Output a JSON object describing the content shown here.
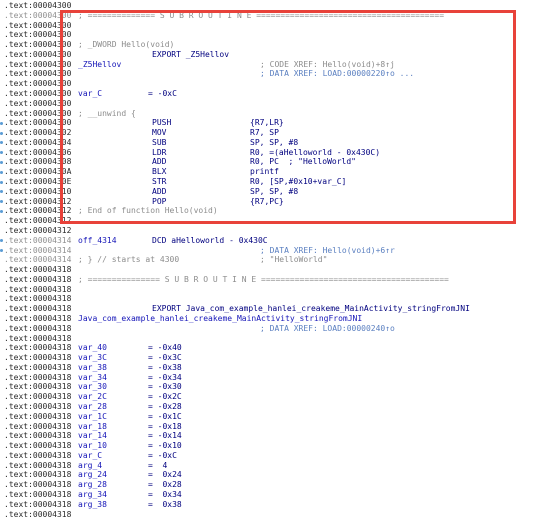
{
  "colors": {
    "address": "#2a2a2a",
    "address_grey": "#909090",
    "label_blue": "#1515b8",
    "mnemonic": "#00007f",
    "operand": "#00007f",
    "comment_grey": "#8c8c8c",
    "xref_blue": "#5a7fc0",
    "highlight_border": "#e8423a",
    "gutter_dot": "#5a9bd4"
  },
  "lines": [
    {
      "addr": ".text:00004300",
      "addr_style": "normal",
      "label": "",
      "mn": "",
      "op": "",
      "cmt": ""
    },
    {
      "addr": ".text:00004300",
      "addr_style": "grey",
      "label": "; ============== S U B R O U T I N E =======================================",
      "mn": "",
      "op": "",
      "cmt": "",
      "label_style": "grey"
    },
    {
      "addr": ".text:00004300",
      "addr_style": "normal",
      "label": "",
      "mn": "",
      "op": "",
      "cmt": ""
    },
    {
      "addr": ".text:00004300",
      "addr_style": "normal",
      "label": "",
      "mn": "",
      "op": "",
      "cmt": ""
    },
    {
      "addr": ".text:00004300",
      "addr_style": "normal",
      "label": "; _DWORD Hello(void)",
      "mn": "",
      "op": "",
      "cmt": "",
      "label_style": "grey"
    },
    {
      "addr": ".text:00004300",
      "addr_style": "normal",
      "label": "",
      "mn": "EXPORT _Z5Hellov",
      "op": "",
      "cmt": ""
    },
    {
      "addr": ".text:00004300",
      "addr_style": "normal",
      "label": "_Z5Hellov",
      "mn": "",
      "op": "",
      "cmt": "; CODE XREF: Hello(void)+8↑j",
      "label_style": "blue"
    },
    {
      "addr": ".text:00004300",
      "addr_style": "normal",
      "label": "",
      "mn": "",
      "op": "",
      "cmt": "; DATA XREF: LOAD:00000220↑o ...",
      "xref": true
    },
    {
      "addr": ".text:00004300",
      "addr_style": "normal",
      "label": "",
      "mn": "",
      "op": "",
      "cmt": ""
    },
    {
      "addr": ".text:00004300",
      "addr_style": "normal",
      "label": "var_C",
      "eq": "= -0xC",
      "mn": "",
      "op": "",
      "cmt": "",
      "label_style": "blue"
    },
    {
      "addr": ".text:00004300",
      "addr_style": "normal",
      "label": "",
      "mn": "",
      "op": "",
      "cmt": ""
    },
    {
      "addr": ".text:00004300",
      "addr_style": "normal",
      "label": "; __unwind {",
      "mn": "",
      "op": "",
      "cmt": "",
      "label_style": "grey"
    },
    {
      "addr": ".text:00004300",
      "addr_style": "normal",
      "label": "",
      "mn": "PUSH",
      "op": "{R7,LR}",
      "cmt": ""
    },
    {
      "addr": ".text:00004302",
      "addr_style": "normal",
      "label": "",
      "mn": "MOV",
      "op": "R7, SP",
      "cmt": ""
    },
    {
      "addr": ".text:00004304",
      "addr_style": "normal",
      "label": "",
      "mn": "SUB",
      "op": "SP, SP, #8",
      "cmt": ""
    },
    {
      "addr": ".text:00004306",
      "addr_style": "normal",
      "label": "",
      "mn": "LDR",
      "op": "R0, =(aHelloworld - 0x430C)",
      "cmt": ""
    },
    {
      "addr": ".text:00004308",
      "addr_style": "normal",
      "label": "",
      "mn": "ADD",
      "op": "R0, PC  ; \"HelloWorld\"",
      "cmt": ""
    },
    {
      "addr": ".text:0000430A",
      "addr_style": "normal",
      "label": "",
      "mn": "BLX",
      "op": "printf",
      "cmt": ""
    },
    {
      "addr": ".text:0000430E",
      "addr_style": "normal",
      "label": "",
      "mn": "STR",
      "op": "R0, [SP,#0x10+var_C]",
      "cmt": ""
    },
    {
      "addr": ".text:00004310",
      "addr_style": "normal",
      "label": "",
      "mn": "ADD",
      "op": "SP, SP, #8",
      "cmt": ""
    },
    {
      "addr": ".text:00004312",
      "addr_style": "normal",
      "label": "",
      "mn": "POP",
      "op": "{R7,PC}",
      "cmt": ""
    },
    {
      "addr": ".text:00004312",
      "addr_style": "normal",
      "label": "; End of function Hello(void)",
      "mn": "",
      "op": "",
      "cmt": "",
      "label_style": "grey"
    },
    {
      "addr": ".text:00004312",
      "addr_style": "normal",
      "label": "",
      "mn": "",
      "op": "",
      "cmt": ""
    },
    {
      "addr": ".text:00004312",
      "addr_style": "normal",
      "label": "",
      "mn": "",
      "op": "",
      "cmt": ""
    },
    {
      "addr": ".text:00004314",
      "addr_style": "grey",
      "label": "off_4314",
      "mn": "DCD aHelloworld - 0x430C",
      "op": "",
      "cmt": "",
      "label_style": "blue"
    },
    {
      "addr": ".text:00004314",
      "addr_style": "grey",
      "label": "",
      "mn": "",
      "op": "",
      "cmt": "; DATA XREF: Hello(void)+6↑r",
      "xref": true
    },
    {
      "addr": ".text:00004314",
      "addr_style": "grey",
      "label": "; } // starts at 4300",
      "mn": "",
      "op": "",
      "cmt": "; \"HelloWorld\"",
      "label_style": "grey",
      "cmt_grey": true
    },
    {
      "addr": ".text:00004318",
      "addr_style": "normal",
      "label": "",
      "mn": "",
      "op": "",
      "cmt": ""
    },
    {
      "addr": ".text:00004318",
      "addr_style": "normal",
      "label": "; =============== S U B R O U T I N E =======================================",
      "mn": "",
      "op": "",
      "cmt": "",
      "label_style": "grey"
    },
    {
      "addr": ".text:00004318",
      "addr_style": "normal",
      "label": "",
      "mn": "",
      "op": "",
      "cmt": ""
    },
    {
      "addr": ".text:00004318",
      "addr_style": "normal",
      "label": "",
      "mn": "",
      "op": "",
      "cmt": ""
    },
    {
      "addr": ".text:00004318",
      "addr_style": "normal",
      "label": "",
      "mn": "EXPORT Java_com_example_hanlei_creakeme_MainActivity_stringFromJNI",
      "op": "",
      "cmt": ""
    },
    {
      "addr": ".text:00004318",
      "addr_style": "normal",
      "label": "Java_com_example_hanlei_creakeme_MainActivity_stringFromJNI",
      "mn": "",
      "op": "",
      "cmt": "",
      "label_style": "blue"
    },
    {
      "addr": ".text:00004318",
      "addr_style": "normal",
      "label": "",
      "mn": "",
      "op": "",
      "cmt": "; DATA XREF: LOAD:00000240↑o",
      "xref": true
    },
    {
      "addr": ".text:00004318",
      "addr_style": "normal",
      "label": "",
      "mn": "",
      "op": "",
      "cmt": ""
    },
    {
      "addr": ".text:00004318",
      "addr_style": "normal",
      "label": "var_40",
      "eq": "= -0x40",
      "mn": "",
      "op": "",
      "cmt": "",
      "label_style": "blue"
    },
    {
      "addr": ".text:00004318",
      "addr_style": "normal",
      "label": "var_3C",
      "eq": "= -0x3C",
      "mn": "",
      "op": "",
      "cmt": "",
      "label_style": "blue"
    },
    {
      "addr": ".text:00004318",
      "addr_style": "normal",
      "label": "var_38",
      "eq": "= -0x38",
      "mn": "",
      "op": "",
      "cmt": "",
      "label_style": "blue"
    },
    {
      "addr": ".text:00004318",
      "addr_style": "normal",
      "label": "var_34",
      "eq": "= -0x34",
      "mn": "",
      "op": "",
      "cmt": "",
      "label_style": "blue"
    },
    {
      "addr": ".text:00004318",
      "addr_style": "normal",
      "label": "var_30",
      "eq": "= -0x30",
      "mn": "",
      "op": "",
      "cmt": "",
      "label_style": "blue"
    },
    {
      "addr": ".text:00004318",
      "addr_style": "normal",
      "label": "var_2C",
      "eq": "= -0x2C",
      "mn": "",
      "op": "",
      "cmt": "",
      "label_style": "blue"
    },
    {
      "addr": ".text:00004318",
      "addr_style": "normal",
      "label": "var_28",
      "eq": "= -0x28",
      "mn": "",
      "op": "",
      "cmt": "",
      "label_style": "blue"
    },
    {
      "addr": ".text:00004318",
      "addr_style": "normal",
      "label": "var_1C",
      "eq": "= -0x1C",
      "mn": "",
      "op": "",
      "cmt": "",
      "label_style": "blue"
    },
    {
      "addr": ".text:00004318",
      "addr_style": "normal",
      "label": "var_18",
      "eq": "= -0x18",
      "mn": "",
      "op": "",
      "cmt": "",
      "label_style": "blue"
    },
    {
      "addr": ".text:00004318",
      "addr_style": "normal",
      "label": "var_14",
      "eq": "= -0x14",
      "mn": "",
      "op": "",
      "cmt": "",
      "label_style": "blue"
    },
    {
      "addr": ".text:00004318",
      "addr_style": "normal",
      "label": "var_10",
      "eq": "= -0x10",
      "mn": "",
      "op": "",
      "cmt": "",
      "label_style": "blue"
    },
    {
      "addr": ".text:00004318",
      "addr_style": "normal",
      "label": "var_C",
      "eq": "= -0xC",
      "mn": "",
      "op": "",
      "cmt": "",
      "label_style": "blue"
    },
    {
      "addr": ".text:00004318",
      "addr_style": "normal",
      "label": "arg_4",
      "eq": "=  4",
      "mn": "",
      "op": "",
      "cmt": "",
      "label_style": "blue"
    },
    {
      "addr": ".text:00004318",
      "addr_style": "normal",
      "label": "arg_24",
      "eq": "=  0x24",
      "mn": "",
      "op": "",
      "cmt": "",
      "label_style": "blue"
    },
    {
      "addr": ".text:00004318",
      "addr_style": "normal",
      "label": "arg_28",
      "eq": "=  0x28",
      "mn": "",
      "op": "",
      "cmt": "",
      "label_style": "blue"
    },
    {
      "addr": ".text:00004318",
      "addr_style": "normal",
      "label": "arg_34",
      "eq": "=  0x34",
      "mn": "",
      "op": "",
      "cmt": "",
      "label_style": "blue"
    },
    {
      "addr": ".text:00004318",
      "addr_style": "normal",
      "label": "arg_38",
      "eq": "=  0x38",
      "mn": "",
      "op": "",
      "cmt": "",
      "label_style": "blue"
    },
    {
      "addr": ".text:00004318",
      "addr_style": "normal",
      "label": "",
      "mn": "",
      "op": "",
      "cmt": ""
    }
  ]
}
